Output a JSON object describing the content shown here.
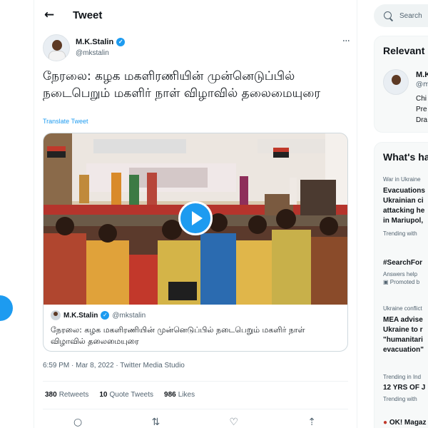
{
  "header": {
    "title": "Tweet"
  },
  "tweet": {
    "author_name": "M.K.Stalin",
    "author_handle": "@mkstalin",
    "text": "நேரலை: கழக மகளிரணியின் முன்னெடுப்பில் நடைபெறும் மகளிர் நாள் விழாவில் தலைமையுரை",
    "translate_label": "Translate Tweet",
    "quote": {
      "name": "M.K.Stalin",
      "handle": "@mkstalin",
      "text": "நேரலை: கழக மகளிரணியின் முன்னெடுப்பில் நடைபெறும் மகளிர் நாள் விழாவில் தலைமையுரை"
    },
    "time": "6:59 PM",
    "date": "Mar 8, 2022",
    "source": "Twitter Media Studio",
    "meta_separator": "·",
    "retweets": {
      "count": "380",
      "label": "Retweets"
    },
    "quotes": {
      "count": "10",
      "label": "Quote Tweets"
    },
    "likes": {
      "count": "986",
      "label": "Likes"
    }
  },
  "search": {
    "placeholder": "Search"
  },
  "relevant": {
    "title": "Relevant people",
    "person": {
      "name": "M.K",
      "handle": "@m",
      "bio_lines": [
        "Chi",
        "Pre",
        "Dra"
      ]
    }
  },
  "trends": {
    "title": "What's happening",
    "items": [
      {
        "context": "War in Ukraine",
        "title_lines": [
          "Evacuations",
          "Ukrainian ci",
          "attacking he",
          "in Mariupol,"
        ],
        "sub": "Trending with"
      },
      {
        "context": "",
        "title_lines": [
          "#SearchFor"
        ],
        "sub": "Answers help",
        "sub2": "Promoted b"
      },
      {
        "context": "Ukraine conflict",
        "title_lines": [
          "MEA advise",
          "Ukraine to r",
          "\"humanitari",
          "evacuation\""
        ],
        "sub": ""
      },
      {
        "context": "Trending in Ind",
        "title_lines": [
          "12 YRS OF J"
        ],
        "sub": "Trending with"
      },
      {
        "context": "OK! Magaz",
        "title_lines": [],
        "sub": ""
      }
    ]
  },
  "colors": {
    "accent": "#1d9bf0",
    "text": "#0f1419",
    "muted": "#536471"
  },
  "icons": {
    "back": "back-arrow-icon",
    "more": "more-icon",
    "verified": "verified-badge-icon",
    "play": "play-icon",
    "reply": "reply-icon",
    "retweet": "retweet-icon",
    "like": "heart-icon",
    "share": "share-icon",
    "search": "search-icon"
  }
}
